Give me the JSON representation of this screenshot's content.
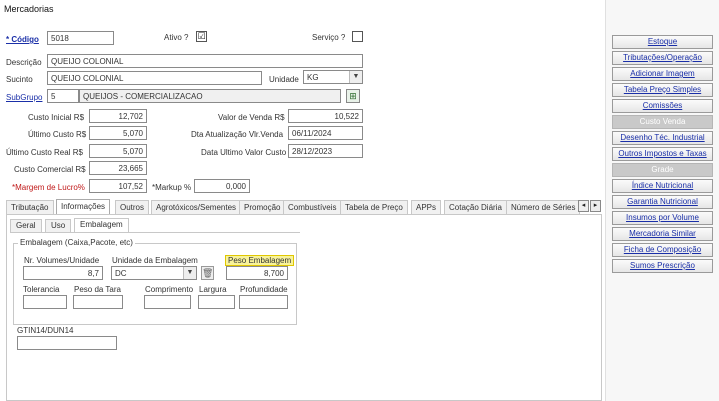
{
  "window": {
    "title": "Mercadorias"
  },
  "form": {
    "codigo_label": "* Código",
    "codigo_value": "5018",
    "ativo_label": "Ativo ?",
    "ativo_checked": "☑",
    "servico_label": "Serviço ?",
    "descricao_label": "Descrição",
    "descricao_value": "QUEIJO COLONIAL",
    "sucinto_label": "Sucinto",
    "sucinto_value": "QUEIJO COLONIAL",
    "unidade_label": "Unidade",
    "unidade_value": "KG",
    "subgrupo_label": "SubGrupo",
    "subgrupo_code": "5",
    "subgrupo_name": "QUEIJOS - COMERCIALIZACAO",
    "custo_inicial_label": "Custo Inicial R$",
    "custo_inicial_value": "12,702",
    "ultimo_custo_label": "Último Custo R$",
    "ultimo_custo_value": "5,070",
    "ultimo_custo_real_label": "Último Custo Real R$",
    "ultimo_custo_real_value": "5,070",
    "custo_comercial_label": "Custo Comercial R$",
    "custo_comercial_value": "23,665",
    "margem_label": "*Margem de Lucro%",
    "margem_value": "107,52",
    "markup_label": "*Markup %",
    "markup_value": "0,000",
    "valor_venda_label": "Valor de Venda R$",
    "valor_venda_value": "10,522",
    "dt_atualizacao_label": "Dta Atualização Vlr.Venda",
    "dt_atualizacao_value": "06/11/2024",
    "dt_ultimo_custo_label": "Data Ultimo Valor Custo",
    "dt_ultimo_custo_value": "28/12/2023"
  },
  "tabs": [
    {
      "label": "Tributação"
    },
    {
      "label": "Informações"
    },
    {
      "label": "Outros"
    },
    {
      "label": "Agrotóxicos/Sementes"
    },
    {
      "label": "Promoção"
    },
    {
      "label": "Combustíveis"
    },
    {
      "label": "Tabela de Preço"
    },
    {
      "label": "APPs"
    },
    {
      "label": "Cotação Diária"
    },
    {
      "label": "Número de Séries"
    }
  ],
  "subtabs": [
    {
      "label": "Geral"
    },
    {
      "label": "Uso"
    },
    {
      "label": "Embalagem"
    }
  ],
  "embalagem": {
    "group_title": "Embalagem (Caixa,Pacote, etc)",
    "nr_volumes_label": "Nr. Volumes/Unidade",
    "nr_volumes_value": "8,7",
    "unidade_embalagem_label": "Unidade da Embalagem",
    "unidade_embalagem_value": "DC",
    "peso_embalagem_label": "Peso Embalagem",
    "peso_embalagem_value": "8,700",
    "tolerancia_label": "Tolerancia",
    "peso_tara_label": "Peso da Tara",
    "comprimento_label": "Comprimento",
    "largura_label": "Largura",
    "profundidade_label": "Profundidade",
    "gtin_label": "GTIN14/DUN14"
  },
  "right_buttons": [
    {
      "label": "Estoque",
      "enabled": true
    },
    {
      "label": "Tributações/Operação",
      "enabled": true
    },
    {
      "label": "Adicionar Imagem",
      "enabled": true
    },
    {
      "label": "Tabela Preço Simples",
      "enabled": true
    },
    {
      "label": "Comissões",
      "enabled": true
    },
    {
      "label": "Custo Venda",
      "enabled": false
    },
    {
      "label": "Desenho Téc. Industrial",
      "enabled": true
    },
    {
      "label": "Outros Impostos e Taxas",
      "enabled": true
    },
    {
      "label": "Grade",
      "enabled": false
    },
    {
      "label": "Índice Nutricional",
      "enabled": true
    },
    {
      "label": "Garantia Nutricional",
      "enabled": true
    },
    {
      "label": "Insumos por Volume",
      "enabled": true
    },
    {
      "label": "Mercadoria Similar",
      "enabled": true
    },
    {
      "label": "Ficha de Composição",
      "enabled": true
    },
    {
      "label": "Sumos Prescrição",
      "enabled": true
    }
  ],
  "colors": {
    "link": "#1a2fa8",
    "required": "#c01818",
    "highlight": "#f8f39a"
  }
}
